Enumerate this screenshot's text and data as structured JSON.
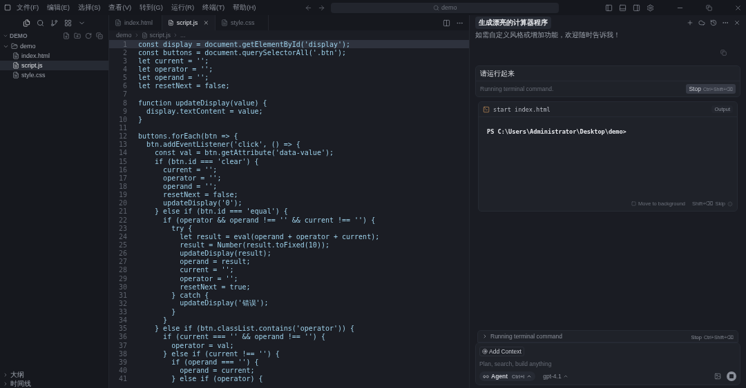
{
  "menu": [
    "文件(F)",
    "编辑(E)",
    "选择(S)",
    "查看(V)",
    "转到(G)",
    "运行(R)",
    "终端(T)",
    "帮助(H)"
  ],
  "command_center": {
    "value": "demo"
  },
  "explorer": {
    "title": "DEMO",
    "tree": [
      {
        "label": "demo",
        "kind": "folder",
        "expanded": true,
        "children": [
          {
            "label": "index.html",
            "kind": "file",
            "selected": false
          },
          {
            "label": "script.js",
            "kind": "file",
            "selected": true
          },
          {
            "label": "style.css",
            "kind": "file",
            "selected": false
          }
        ]
      }
    ],
    "bottom_sections": [
      "大纲",
      "时间线"
    ]
  },
  "tabs": [
    {
      "label": "index.html",
      "selected": false
    },
    {
      "label": "script.js",
      "selected": true
    },
    {
      "label": "style.css",
      "selected": false
    }
  ],
  "breadcrumb": [
    "demo",
    "script.js",
    "..."
  ],
  "code": [
    {
      "number": "1",
      "code": "const display = document.getElementById('display');",
      "current": true
    },
    {
      "number": "2",
      "code": "const buttons = document.querySelectorAll('.btn');",
      "current": false
    },
    {
      "number": "3",
      "code": "let current = '';",
      "current": false
    },
    {
      "number": "4",
      "code": "let operator = '';",
      "current": false
    },
    {
      "number": "5",
      "code": "let operand = '';",
      "current": false
    },
    {
      "number": "6",
      "code": "let resetNext = false;",
      "current": false
    },
    {
      "number": "7",
      "current": false
    },
    {
      "number": "8",
      "code": "function updateDisplay(value) {",
      "current": false
    },
    {
      "number": "9",
      "code": "  display.textContent = value;",
      "current": false
    },
    {
      "number": "10",
      "code": "}",
      "current": false
    },
    {
      "number": "11",
      "current": false
    },
    {
      "number": "12",
      "code": "buttons.forEach(btn => {",
      "current": false
    },
    {
      "number": "13",
      "code": "  btn.addEventListener('click', () => {",
      "current": false
    },
    {
      "number": "14",
      "code": "    const val = btn.getAttribute('data-value');",
      "current": false
    },
    {
      "number": "15",
      "code": "    if (btn.id === 'clear') {",
      "current": false
    },
    {
      "number": "16",
      "code": "      current = '';",
      "current": false
    },
    {
      "number": "17",
      "code": "      operator = '';",
      "current": false
    },
    {
      "number": "18",
      "code": "      operand = '';",
      "current": false
    },
    {
      "number": "19",
      "code": "      resetNext = false;",
      "current": false
    },
    {
      "number": "20",
      "code": "      updateDisplay('0');",
      "current": false
    },
    {
      "number": "21",
      "code": "    } else if (btn.id === 'equal') {",
      "current": false
    },
    {
      "number": "22",
      "code": "      if (operator && operand !== '' && current !== '') {",
      "current": false
    },
    {
      "number": "23",
      "code": "        try {",
      "current": false
    },
    {
      "number": "24",
      "code": "          let result = eval(operand + operator + current);",
      "current": false
    },
    {
      "number": "25",
      "code": "          result = Number(result.toFixed(10));",
      "current": false
    },
    {
      "number": "26",
      "code": "          updateDisplay(result);",
      "current": false
    },
    {
      "number": "27",
      "code": "          operand = result;",
      "current": false
    },
    {
      "number": "28",
      "code": "          current = '';",
      "current": false
    },
    {
      "number": "29",
      "code": "          operator = '';",
      "current": false
    },
    {
      "number": "30",
      "code": "          resetNext = true;",
      "current": false
    },
    {
      "number": "31",
      "code": "        } catch {",
      "current": false
    },
    {
      "number": "32",
      "code": "          updateDisplay('错误');",
      "current": false
    },
    {
      "number": "33",
      "code": "        }",
      "current": false
    },
    {
      "number": "34",
      "code": "      }",
      "current": false
    },
    {
      "number": "35",
      "code": "    } else if (btn.classList.contains('operator')) {",
      "current": false
    },
    {
      "number": "36",
      "code": "      if (current === '' && operand !== '') {",
      "current": false
    },
    {
      "number": "37",
      "code": "        operator = val;",
      "current": false
    },
    {
      "number": "38",
      "code": "      } else if (current !== '') {",
      "current": false
    },
    {
      "number": "39",
      "code": "        if (operand === '') {",
      "current": false
    },
    {
      "number": "40",
      "code": "          operand = current;",
      "current": false
    },
    {
      "number": "41",
      "code": "        } else if (operator) {",
      "current": false
    }
  ],
  "chat": {
    "title": "生成漂亮的计算器程序",
    "previous_message": "如需自定义风格或增加功能，欢迎随时告诉我！",
    "user_message": "请运行起来",
    "status": "Running terminal command.",
    "stop": {
      "label": "Stop",
      "shortcut": "Ctrl+Shift+⌫"
    },
    "terminal": {
      "command": "start index.html",
      "output_label": "Output",
      "output": "PS C:\\Users\\Administrator\\Desktop\\demo>",
      "move_to_background": "Move to background",
      "skip_shortcut": "Shift+⌫",
      "skip": "Skip"
    },
    "running_bar": {
      "label": "Running terminal command",
      "stop": "Stop",
      "shortcut": "Ctrl+Shift+⌫"
    },
    "composer": {
      "add_context": "Add Context",
      "placeholder": "Plan, search, build anything",
      "mode": "Agent",
      "mode_shortcut": "Ctrl+I",
      "model": "gpt-4.1"
    }
  }
}
